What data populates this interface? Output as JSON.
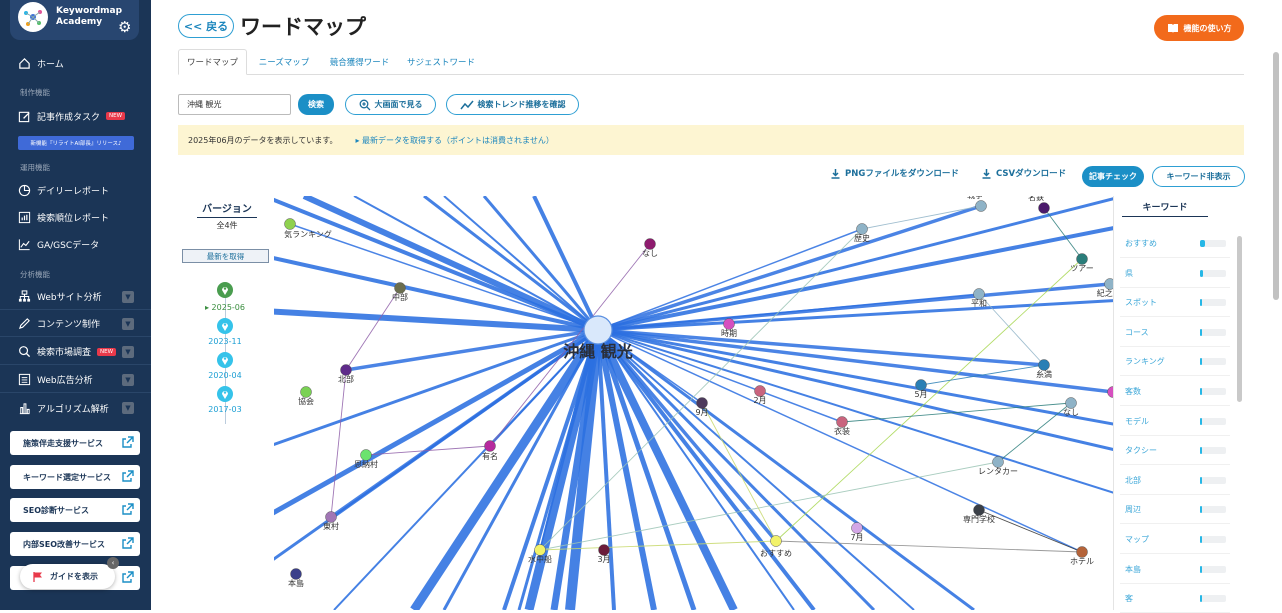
{
  "sidebar": {
    "brand": "Keywordmap Academy",
    "home": "ホーム",
    "section_create": "制作機能",
    "article_task": "記事作成タスク",
    "new_badge": "NEW",
    "news": "新機能『リライトAI部長』リリース♪",
    "section_ops": "運用機能",
    "daily_report": "デイリーレポート",
    "rank_report": "検索順位レポート",
    "ga_gsc": "GA/GSCデータ",
    "section_analysis": "分析機能",
    "web_analysis": "Webサイト分析",
    "content_create": "コンテンツ制作",
    "market_research": "検索市場調査",
    "ad_analysis": "Web広告分析",
    "algo_analysis": "アルゴリズム解析",
    "services": [
      "施策伴走支援サービス",
      "キーワード選定サービス",
      "SEO診断サービス",
      "内部SEO改善サービス"
    ],
    "guide": "ガイドを表示"
  },
  "header": {
    "back": "<< 戻る",
    "title": "ワードマップ",
    "howto": "機能の使い方"
  },
  "tabs": [
    "ワードマップ",
    "ニーズマップ",
    "競合獲得ワード",
    "サジェストワード"
  ],
  "search": {
    "value": "沖縄 観光",
    "button": "検索",
    "fullscreen": "大画面で見る",
    "trend": "検索トレンド推移を確認"
  },
  "notice": {
    "text": "2025年06月のデータを表示しています。",
    "link": "▸ 最新データを取得する（ポイントは消費されません）"
  },
  "toolbar": {
    "png": "PNGファイルをダウンロード",
    "csv": "CSVダウンロード",
    "check": "記事チェック",
    "hide": "キーワード非表示"
  },
  "version": {
    "title": "バージョン",
    "count": "全4件",
    "latest": "最新を取得",
    "dates": [
      "▸ 2025-06",
      "2023-11",
      "2020-04",
      "2017-03"
    ]
  },
  "graph": {
    "center": "沖縄 観光",
    "labels": [
      "気ランキング",
      "なし",
      "戦争",
      "名鉄",
      "歴史",
      "ツアー",
      "紀之 父",
      "中部",
      "平和",
      "時期",
      "北部",
      "協会",
      "9月",
      "5月",
      "糸満",
      "2月",
      "衣装",
      "なし",
      "や",
      "恩納村",
      "有名",
      "レンタカー",
      "東村",
      "専門学校",
      "水中船",
      "3月",
      "おすすめ",
      "7月",
      "ホテル",
      "本島"
    ]
  },
  "keywords": {
    "title": "キーワード",
    "items": [
      {
        "label": "おすすめ",
        "level": 0.18
      },
      {
        "label": "県",
        "level": 0.1
      },
      {
        "label": "スポット",
        "level": 0.06
      },
      {
        "label": "コース",
        "level": 0.05
      },
      {
        "label": "ランキング",
        "level": 0.05
      },
      {
        "label": "客数",
        "level": 0.05
      },
      {
        "label": "モデル",
        "level": 0.04
      },
      {
        "label": "タクシー",
        "level": 0.04
      },
      {
        "label": "北部",
        "level": 0.04
      },
      {
        "label": "周辺",
        "level": 0.04
      },
      {
        "label": "マップ",
        "level": 0.04
      },
      {
        "label": "本島",
        "level": 0.04
      },
      {
        "label": "客",
        "level": 0.04
      }
    ]
  },
  "colors": {
    "sidebar_bg": "#1b3556",
    "accent": "#1b8fc6",
    "orange": "#f26a1b",
    "edge": "#2b6fe0"
  }
}
